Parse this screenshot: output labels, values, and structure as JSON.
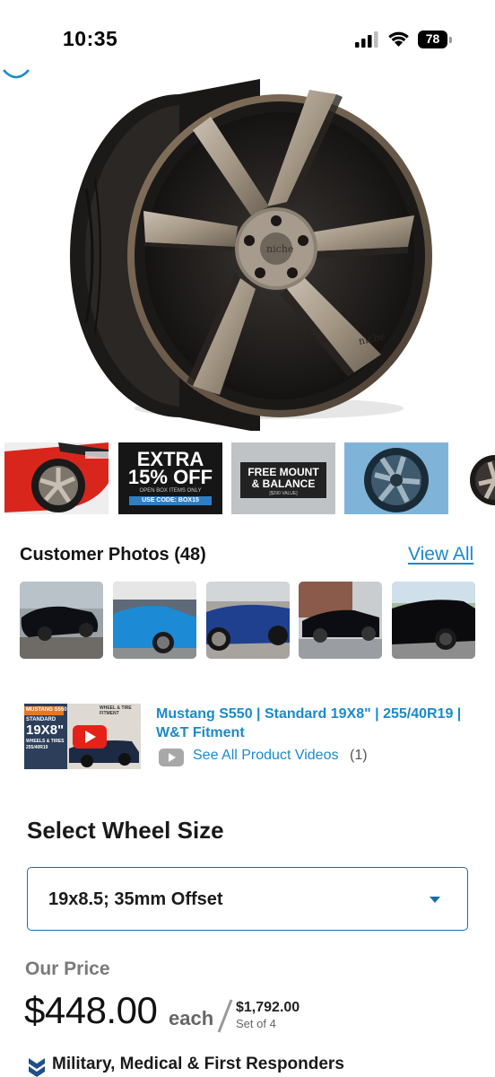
{
  "status_bar": {
    "time": "10:35",
    "battery": "78"
  },
  "gallery": {
    "main_image": "wheel-product-image",
    "thumbnails": [
      {
        "name": "red-mustang-photo"
      },
      {
        "name": "extra-off-promo",
        "line1": "EXTRA",
        "line2": "15% OFF",
        "line3": "OPEN BOX ITEMS ONLY",
        "line4": "USE CODE: BOX15"
      },
      {
        "name": "free-mount-promo",
        "line1": "FREE MOUNT",
        "line2": "& BALANCE",
        "line3": "[$290 VALUE]"
      },
      {
        "name": "blue-wheel-photo"
      },
      {
        "name": "wheel-partial-photo"
      }
    ]
  },
  "customer_photos": {
    "title": "Customer Photos (48)",
    "view_all": "View All",
    "count": 5
  },
  "video": {
    "thumb_model": "MUSTANG S550",
    "thumb_badge": "WHEEL & TIRE FITMENT",
    "thumb_standard": "STANDARD",
    "thumb_size": "19X8\"",
    "thumb_sub": "WHEELS & TIRES",
    "thumb_tire": "255/40R19",
    "title": "Mustang S550 | Standard 19X8\" | 255/40R19 | W&T Fitment",
    "see_all": "See All Product Videos",
    "see_all_count": "(1)"
  },
  "wheel_size": {
    "heading": "Select Wheel Size",
    "selected": "19x8.5; 35mm Offset"
  },
  "price": {
    "label": "Our Price",
    "amount": "$448.00",
    "unit": "each",
    "set_total": "$1,792.00",
    "set_label": "Set of 4"
  },
  "discount": {
    "label": "Military, Medical & First Responders"
  },
  "colors": {
    "link_blue": "#1b8ac8",
    "select_border": "#1a6ea8",
    "text_dark": "#1a1a1a"
  }
}
